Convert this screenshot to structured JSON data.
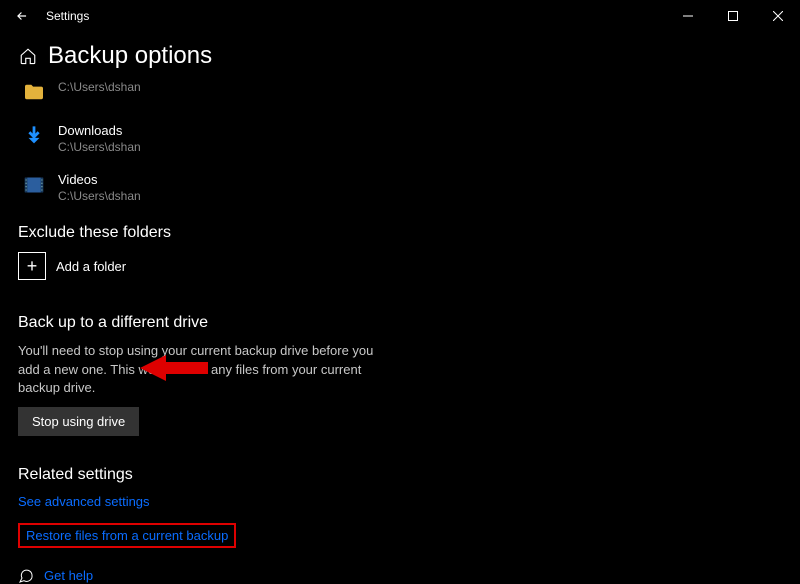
{
  "app_title": "Settings",
  "page_title": "Backup options",
  "folders": [
    {
      "name": "",
      "path": "C:\\Users\\dshan",
      "icon": "folder"
    },
    {
      "name": "Downloads",
      "path": "C:\\Users\\dshan",
      "icon": "download"
    },
    {
      "name": "Videos",
      "path": "C:\\Users\\dshan",
      "icon": "videos"
    }
  ],
  "exclude": {
    "title": "Exclude these folders",
    "add_label": "Add a folder"
  },
  "diff_drive": {
    "title": "Back up to a different drive",
    "desc": "You'll need to stop using your current backup drive before you add a new one. This won't delete any files from your current backup drive.",
    "button": "Stop using drive"
  },
  "related": {
    "title": "Related settings",
    "advanced": "See advanced settings",
    "restore": "Restore files from a current backup"
  },
  "help": {
    "label": "Get help"
  }
}
